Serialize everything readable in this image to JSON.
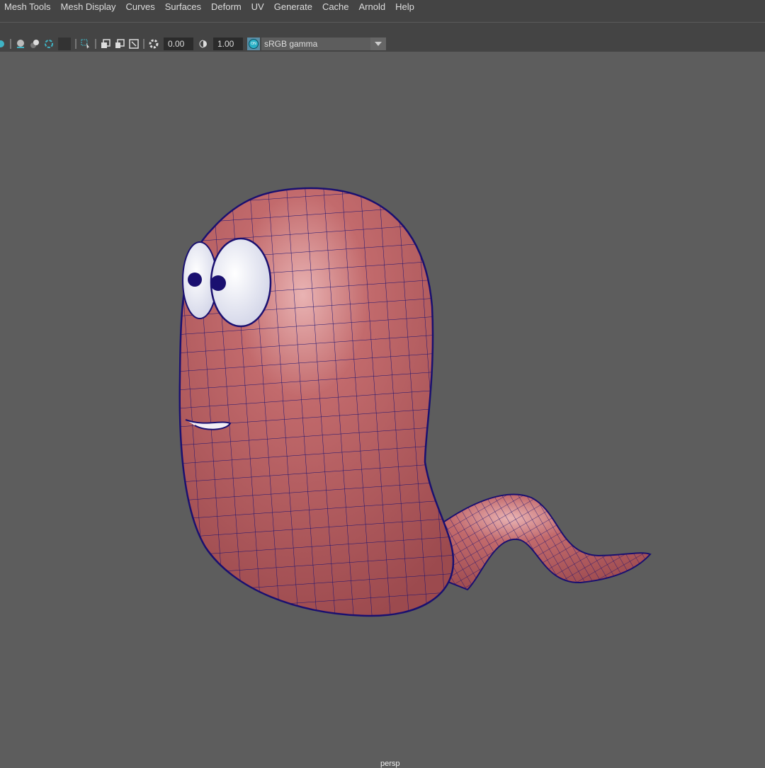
{
  "menubar": {
    "items": [
      "Mesh Tools",
      "Mesh Display",
      "Curves",
      "Surfaces",
      "Deform",
      "UV",
      "Generate",
      "Cache",
      "Arnold",
      "Help"
    ]
  },
  "toolbar": {
    "exposure": "0.00",
    "gamma": "1.00",
    "color_management_toggle": "ON",
    "color_space": "sRGB gamma"
  },
  "viewport": {
    "camera": "persp"
  },
  "colors": {
    "mesh_fill": "#b65a5e",
    "wireframe": "#1a1070",
    "background": "#5d5d5d"
  }
}
